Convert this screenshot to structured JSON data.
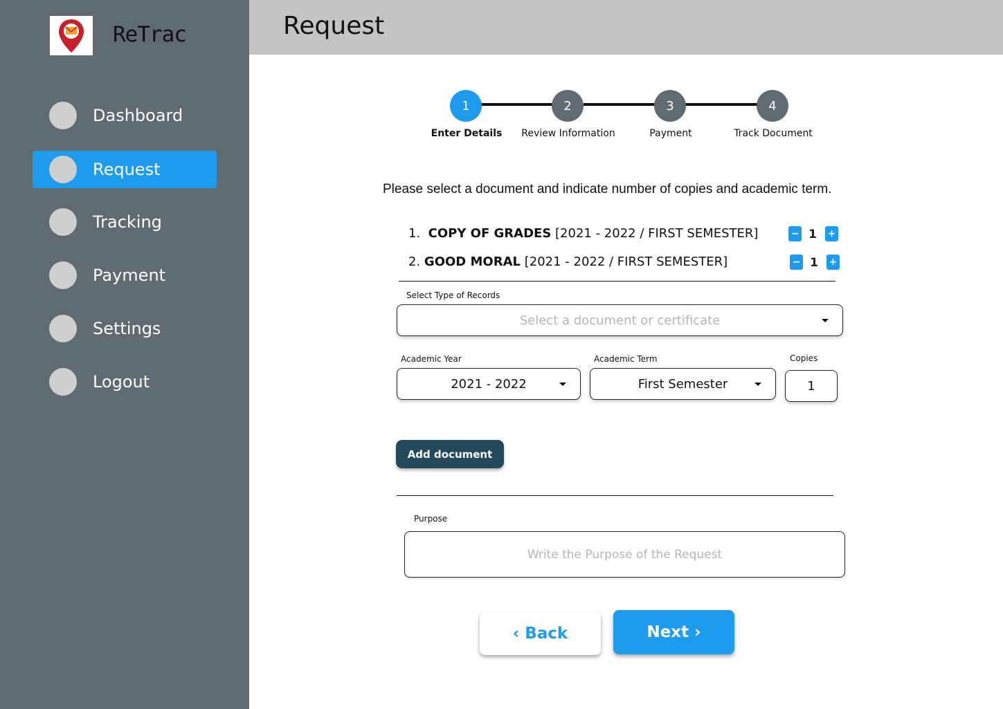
{
  "app": {
    "name": "ReTrac",
    "logo_icon": "map-pin-mail-icon",
    "brand_color": "#1e9bec"
  },
  "sidebar": {
    "items": [
      {
        "label": "Dashboard",
        "active": false
      },
      {
        "label": "Request",
        "active": true
      },
      {
        "label": "Tracking",
        "active": false
      },
      {
        "label": "Payment",
        "active": false
      },
      {
        "label": "Settings",
        "active": false
      },
      {
        "label": "Logout",
        "active": false
      }
    ]
  },
  "header": {
    "title": "Request"
  },
  "stepper": {
    "steps": [
      {
        "number": "1",
        "label": "Enter Details",
        "active": true
      },
      {
        "number": "2",
        "label": "Review Information",
        "active": false
      },
      {
        "number": "3",
        "label": "Payment",
        "active": false
      },
      {
        "number": "4",
        "label": "Track Document",
        "active": false
      }
    ]
  },
  "instruction": "Please select a document and indicate number of copies and academic term.",
  "documents": [
    {
      "index": "1.",
      "name": "COPY OF GRADES",
      "term": "[2021 - 2022 / FIRST SEMESTER]",
      "copies": "1"
    },
    {
      "index": "2.",
      "name": "GOOD MORAL",
      "term": "[2021 - 2022 / FIRST SEMESTER]",
      "copies": "1"
    }
  ],
  "form": {
    "record_type": {
      "label": "Select Type of Records",
      "placeholder": "Select a document or certificate"
    },
    "academic_year": {
      "label": "Academic Year",
      "value": "2021 - 2022"
    },
    "academic_term": {
      "label": "Academic Term",
      "value": "First Semester"
    },
    "copies": {
      "label": "Copies",
      "value": "1"
    },
    "add_button": "Add document",
    "purpose": {
      "label": "Purpose",
      "placeholder": "Write the Purpose of the Request"
    }
  },
  "actions": {
    "back": "‹ Back",
    "next": "Next ›"
  }
}
